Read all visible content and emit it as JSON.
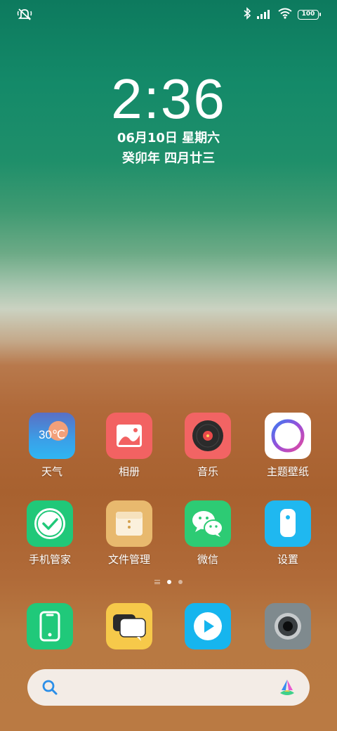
{
  "status_bar": {
    "battery": "100",
    "icons": [
      "mute-bell-icon",
      "bluetooth-icon",
      "signal-icon",
      "wifi-icon",
      "battery-icon"
    ]
  },
  "lockclock": {
    "time": "2:36",
    "date": "06月10日 星期六",
    "lunar": "癸卯年 四月廿三"
  },
  "apps": {
    "weather": {
      "label": "天气",
      "temp": "30℃"
    },
    "album": {
      "label": "相册"
    },
    "music": {
      "label": "音乐"
    },
    "themes": {
      "label": "主题壁纸"
    },
    "phone_manager": {
      "label": "手机管家"
    },
    "file_manager": {
      "label": "文件管理"
    },
    "wechat": {
      "label": "微信"
    },
    "settings": {
      "label": "设置"
    }
  },
  "dock": {
    "items": [
      "phone-icon",
      "messages-icon",
      "video-player-icon",
      "camera-icon"
    ]
  },
  "page_indicator": {
    "pages": 2,
    "active": 1
  },
  "search": {
    "icons": [
      "search-icon",
      "assistant-icon"
    ]
  }
}
